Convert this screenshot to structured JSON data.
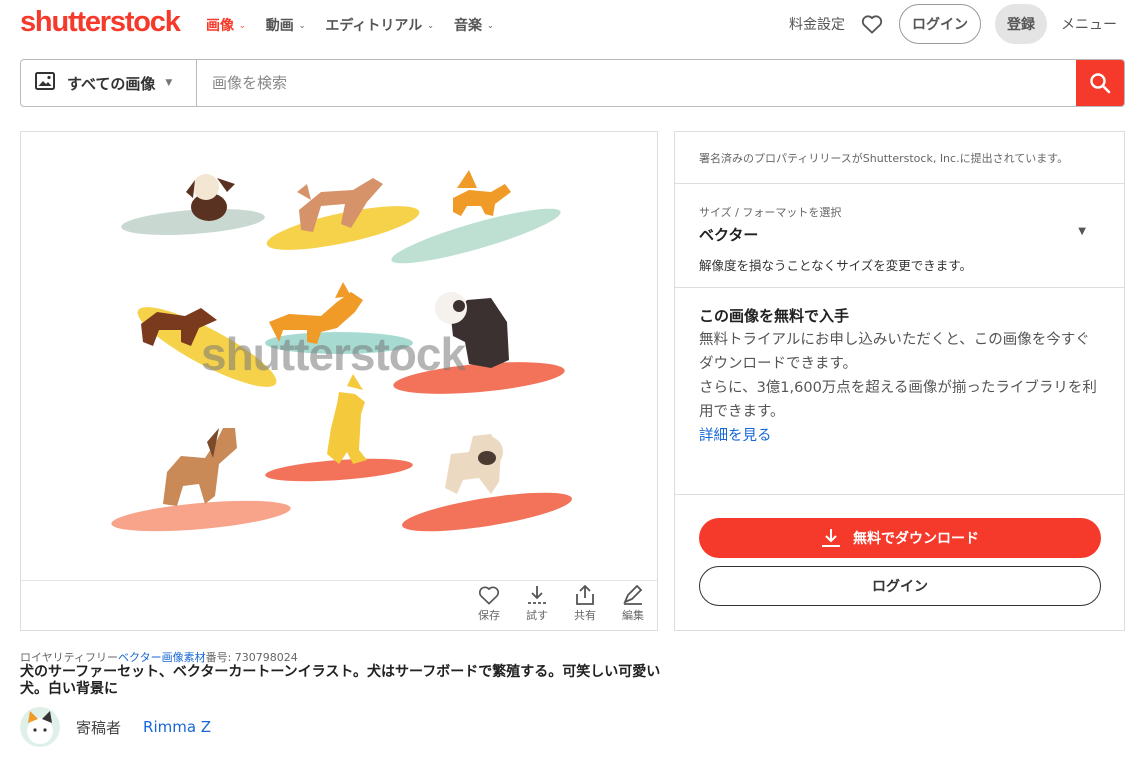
{
  "brand": {
    "logo": "shutterstock",
    "accent": "#f5392b",
    "link_color": "#1767d6"
  },
  "nav": [
    {
      "label": "画像",
      "active": true
    },
    {
      "label": "動画",
      "active": false
    },
    {
      "label": "エディトリアル",
      "active": false
    },
    {
      "label": "音楽",
      "active": false
    }
  ],
  "header": {
    "pricing": "料金設定",
    "favorites_icon": "heart-icon",
    "login": "ログイン",
    "register": "登録",
    "menu": "メニュー"
  },
  "search": {
    "type": "すべての画像",
    "type_icon": "image-icon",
    "placeholder": "画像を検索",
    "button_icon": "search-icon"
  },
  "preview": {
    "watermark": "shutterstock"
  },
  "actions": [
    {
      "label": "保存",
      "icon": "heart-icon"
    },
    {
      "label": "試す",
      "icon": "download-icon"
    },
    {
      "label": "共有",
      "icon": "share-icon"
    },
    {
      "label": "編集",
      "icon": "edit-icon"
    }
  ],
  "side": {
    "release_note": "署名済みのプロパティリリースがShutterstock, Inc.に提出されています。",
    "format_label": "サイズ / フォーマットを選択",
    "format_value": "ベクター",
    "format_desc": "解像度を損なうことなくサイズを変更できます。",
    "free_title": "この画像を無料で入手",
    "free_body_1": "無料トライアルにお申し込みいただくと、この画像を今すぐダウンロードできます。",
    "free_body_2": "さらに、3億1,600万点を超える画像が揃ったライブラリを利用できます。",
    "details_link": "詳細を見る",
    "download_btn": "無料でダウンロード",
    "login_btn": "ログイン"
  },
  "meta": {
    "prefix": "ロイヤリティフリー",
    "category_link": "ベクター画像素材",
    "id_label": "番号:",
    "id": "730798024"
  },
  "image_title": "犬のサーファーセット、ベクターカートーンイラスト。犬はサーフボードで繁殖する。可笑しい可愛い犬。白い背景に",
  "contributor": {
    "label": "寄稿者",
    "name": "Rimma Z"
  }
}
